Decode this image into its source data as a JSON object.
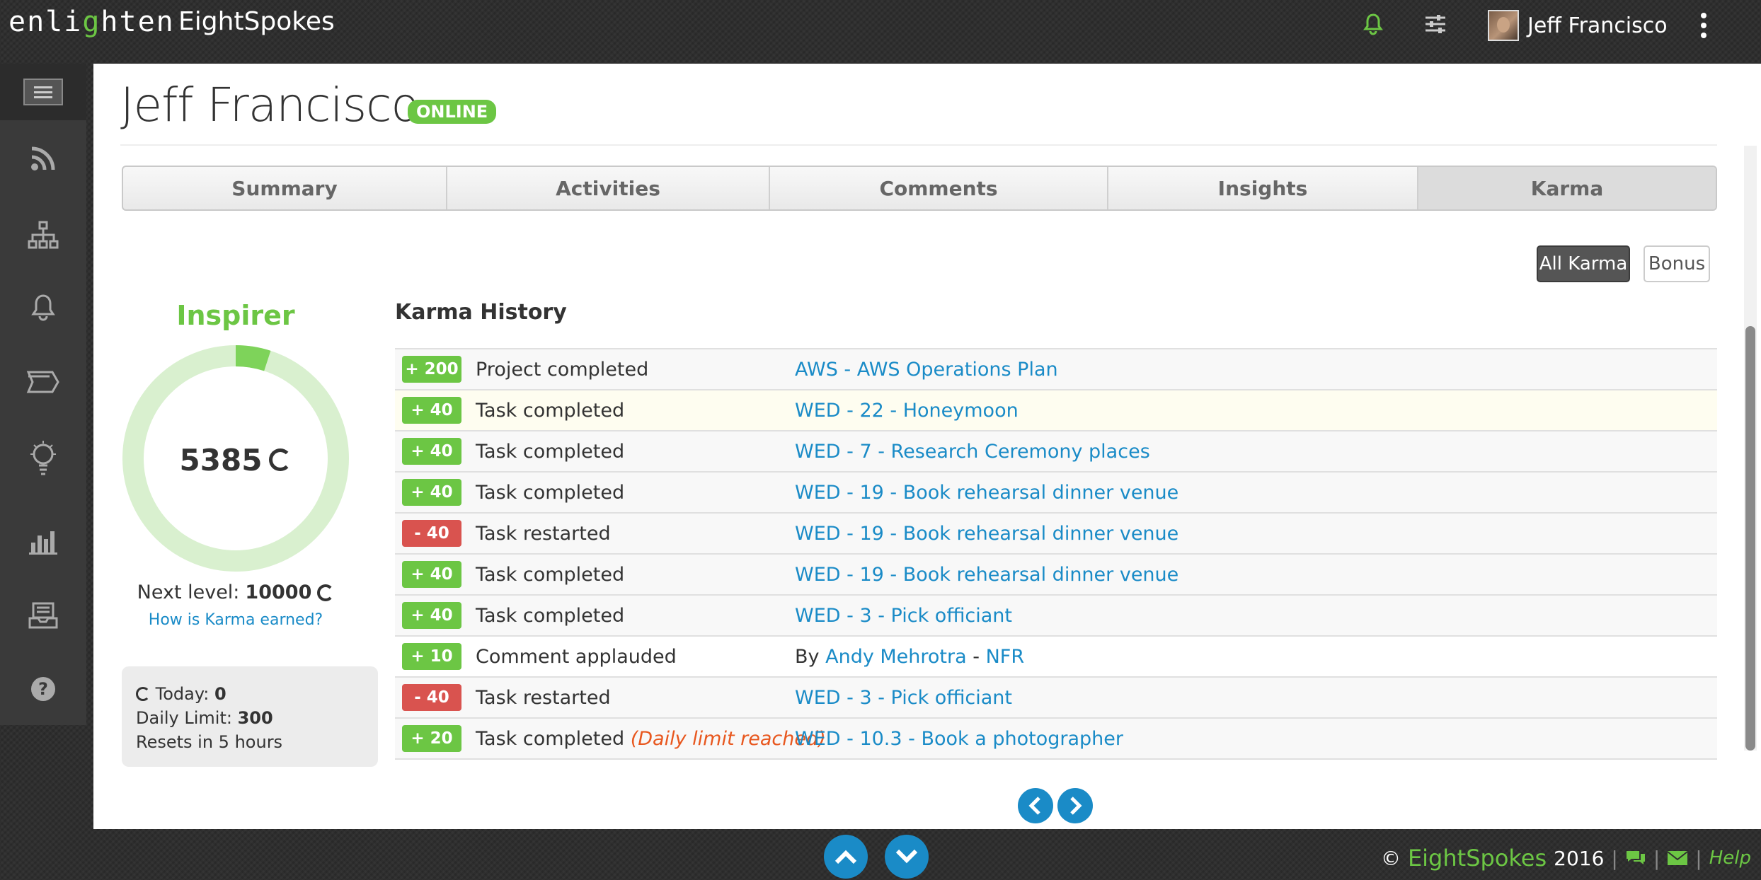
{
  "app": {
    "logo_prefix": "enli",
    "logo_g": "g",
    "logo_suffix": "hten",
    "company": "EightSpokes"
  },
  "header": {
    "user_name": "Jeff Francisco",
    "bell_color": "#6cc644"
  },
  "profile": {
    "name": "Jeff Francisco",
    "status": "ONLINE"
  },
  "tabs": [
    {
      "label": "Summary",
      "active": false
    },
    {
      "label": "Activities",
      "active": false
    },
    {
      "label": "Comments",
      "active": false
    },
    {
      "label": "Insights",
      "active": false
    },
    {
      "label": "Karma",
      "active": true
    }
  ],
  "filters": {
    "all_karma": "All Karma",
    "bonus": "Bonus",
    "selected": "All Karma"
  },
  "karma": {
    "rank": "Inspirer",
    "points": "5385",
    "next_level_label": "Next level:",
    "next_level_value": "10000",
    "progress_fraction": 0.05,
    "how_link": "How is Karma earned?",
    "today_label": "Today:",
    "today_value": "0",
    "daily_limit_label": "Daily Limit:",
    "daily_limit_value": "300",
    "resets": "Resets in 5 hours"
  },
  "history": {
    "title": "Karma History",
    "rows": [
      {
        "points": "+ 200",
        "type": "pos",
        "desc": "Project completed",
        "note": "",
        "by": "",
        "target": "AWS - AWS Operations Plan",
        "target2": ""
      },
      {
        "points": "+ 40",
        "type": "pos",
        "desc": "Task completed",
        "note": "",
        "by": "",
        "target": "WED - 22 - Honeymoon",
        "target2": ""
      },
      {
        "points": "+ 40",
        "type": "pos",
        "desc": "Task completed",
        "note": "",
        "by": "",
        "target": "WED - 7 - Research Ceremony places",
        "target2": ""
      },
      {
        "points": "+ 40",
        "type": "pos",
        "desc": "Task completed",
        "note": "",
        "by": "",
        "target": "WED - 19 - Book rehearsal dinner venue",
        "target2": ""
      },
      {
        "points": "- 40",
        "type": "neg",
        "desc": "Task restarted",
        "note": "",
        "by": "",
        "target": "WED - 19 - Book rehearsal dinner venue",
        "target2": ""
      },
      {
        "points": "+ 40",
        "type": "pos",
        "desc": "Task completed",
        "note": "",
        "by": "",
        "target": "WED - 19 - Book rehearsal dinner venue",
        "target2": ""
      },
      {
        "points": "+ 40",
        "type": "pos",
        "desc": "Task completed",
        "note": "",
        "by": "",
        "target": "WED - 3 - Pick officiant",
        "target2": ""
      },
      {
        "points": "+ 10",
        "type": "pos",
        "desc": "Comment applauded",
        "note": "",
        "by": "By",
        "target": "Andy Mehrotra",
        "target_sep": " - ",
        "target2": "NFR"
      },
      {
        "points": "- 40",
        "type": "neg",
        "desc": "Task restarted",
        "note": "",
        "by": "",
        "target": "WED - 3 - Pick officiant",
        "target2": ""
      },
      {
        "points": "+ 20",
        "type": "pos",
        "desc": "Task completed",
        "note": "(Daily limit reached)",
        "by": "",
        "target": "WED - 10.3 - Book a photographer",
        "target2": ""
      }
    ]
  },
  "footer": {
    "copyright": "©",
    "brand": "EightSpokes",
    "year": "2016",
    "help": "Help"
  },
  "colors": {
    "accent": "#6cc644",
    "link": "#1a8bc7",
    "danger": "#d9534f",
    "note": "#e8571e"
  }
}
